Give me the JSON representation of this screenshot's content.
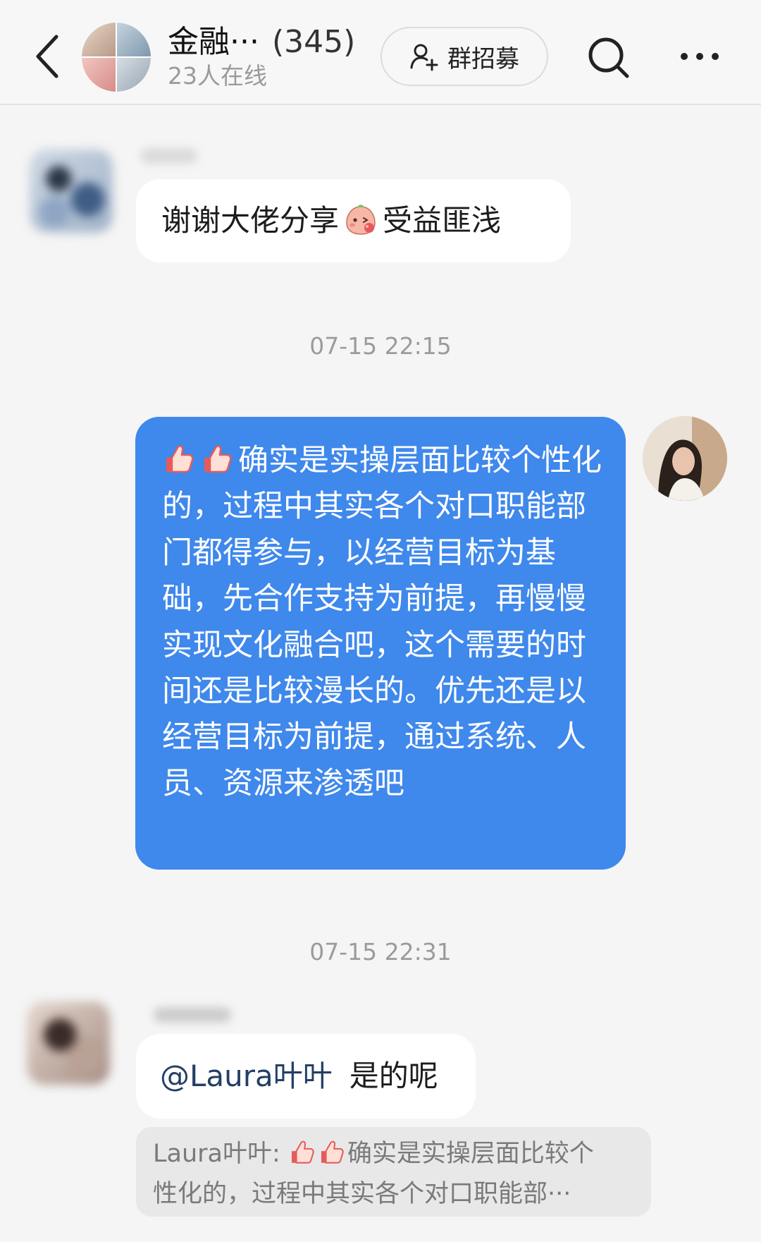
{
  "header": {
    "title": "金融···",
    "member_count": "(345)",
    "online": "23人在线",
    "recruit_label": "群招募"
  },
  "messages": [
    {
      "text_before": "谢谢大佬分享",
      "text_after": "受益匪浅"
    },
    {
      "timestamp": "07-15 22:15",
      "text": "确实是实操层面比较个性化的，过程中其实各个对口职能部门都得参与，以经营目标为基础，先合作支持为前提，再慢慢实现文化融合吧，这个需要的时间还是比较漫长的。优先还是以经营目标为前提，通过系统、人员、资源来渗透吧"
    },
    {
      "timestamp": "07-15 22:31",
      "mention": "@Laura叶叶",
      "text": "是的呢",
      "quote_author": "Laura叶叶:",
      "quote_line1": "确实是实操层面比较个",
      "quote_line2": "性化的，过程中其实各个对口职能部···"
    }
  ],
  "colors": {
    "outgoing_bubble": "#3f88ec",
    "background": "#f5f5f5",
    "mention": "#233f66"
  }
}
